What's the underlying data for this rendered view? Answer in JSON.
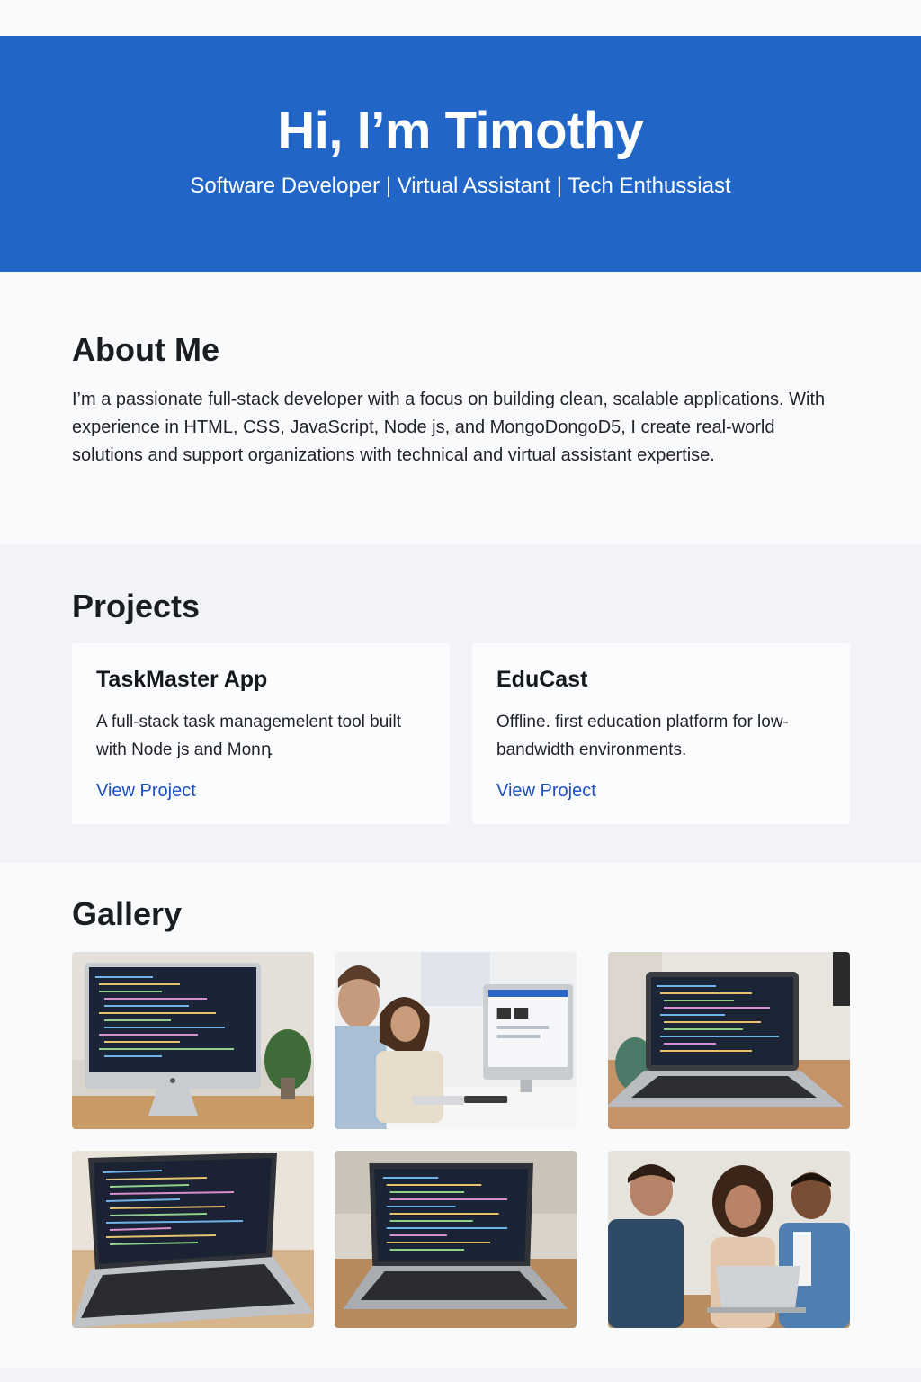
{
  "hero": {
    "title": "Hi, I’m Timothy",
    "subtitle": "Software Developer | Virtual Assistant | Tech Enthussiast"
  },
  "about": {
    "title": "About Me",
    "text": "I’m a passionate full-stack developer with a focus on building clean, scalable applications. With experience in HTML, CSS, JavaScript, Node js, and MongoDongoD5, I create real-world solutions and support organizations with technical and virtual assistant expertise."
  },
  "projects": {
    "title": "Projects",
    "items": [
      {
        "name": "TaskMaster App",
        "description": "A full-stack task managemelent tool built with Node js and Monդ",
        "link_label": "View Project"
      },
      {
        "name": "EduCast",
        "description": "Offline. first education platform for low-bandwidth environments.",
        "link_label": "View Project"
      }
    ]
  },
  "gallery": {
    "title": "Gallery",
    "images": [
      "desktop-monitor-code-photo",
      "people-at-computer-photo",
      "laptop-code-photo",
      "laptop-code-closeup-photo",
      "laptop-code-table-photo",
      "team-meeting-photo"
    ]
  },
  "colors": {
    "hero_background": "#2166c7",
    "link": "#1f4fbf",
    "text": "#1a1d21",
    "section_alt_background": "#f1f3f6"
  }
}
